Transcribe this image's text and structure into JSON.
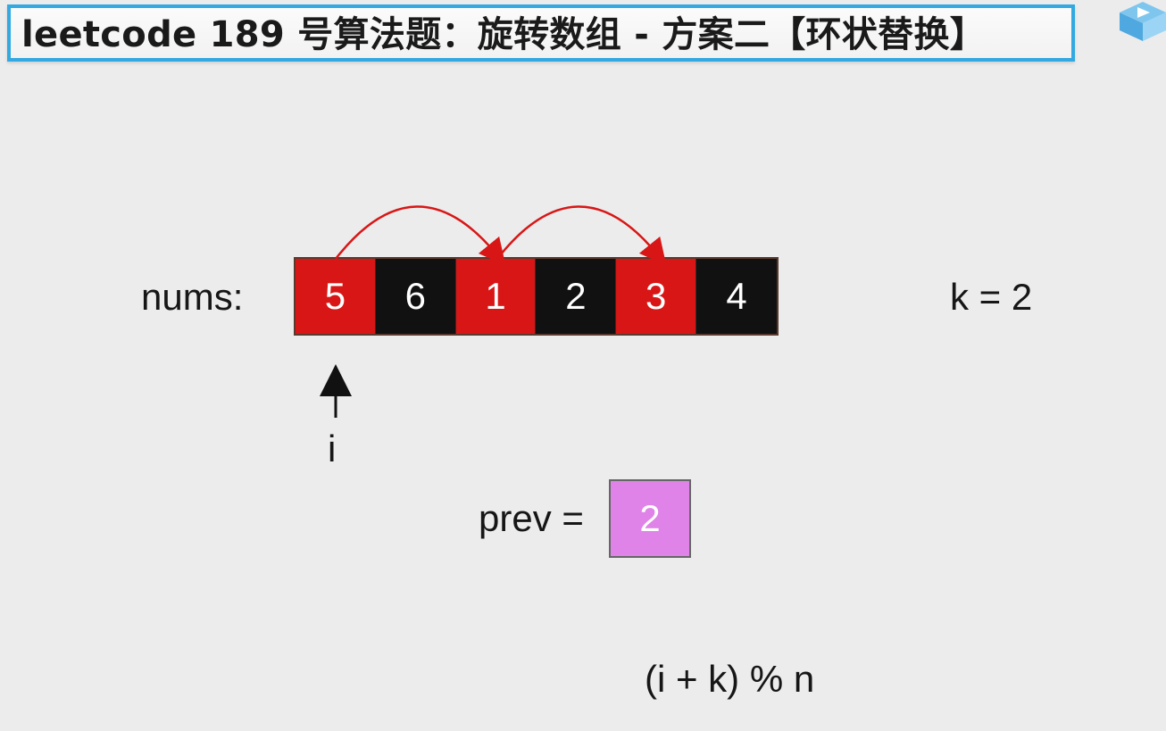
{
  "title": "leetcode 189 号算法题：旋转数组 - 方案二【环状替换】",
  "nums_label": "nums:",
  "nums": [
    {
      "value": "5",
      "color": "red"
    },
    {
      "value": "6",
      "color": "black"
    },
    {
      "value": "1",
      "color": "red"
    },
    {
      "value": "2",
      "color": "black"
    },
    {
      "value": "3",
      "color": "red"
    },
    {
      "value": "4",
      "color": "black"
    }
  ],
  "k_label": "k = 2",
  "pointer_label": "i",
  "prev_label": "prev =",
  "prev_value": "2",
  "formula": "(i + k) % n",
  "colors": {
    "title_border": "#32a9e0",
    "red_cell": "#d81616",
    "black_cell": "#111111",
    "prev_box": "#df83e8",
    "arc": "#d81616"
  }
}
